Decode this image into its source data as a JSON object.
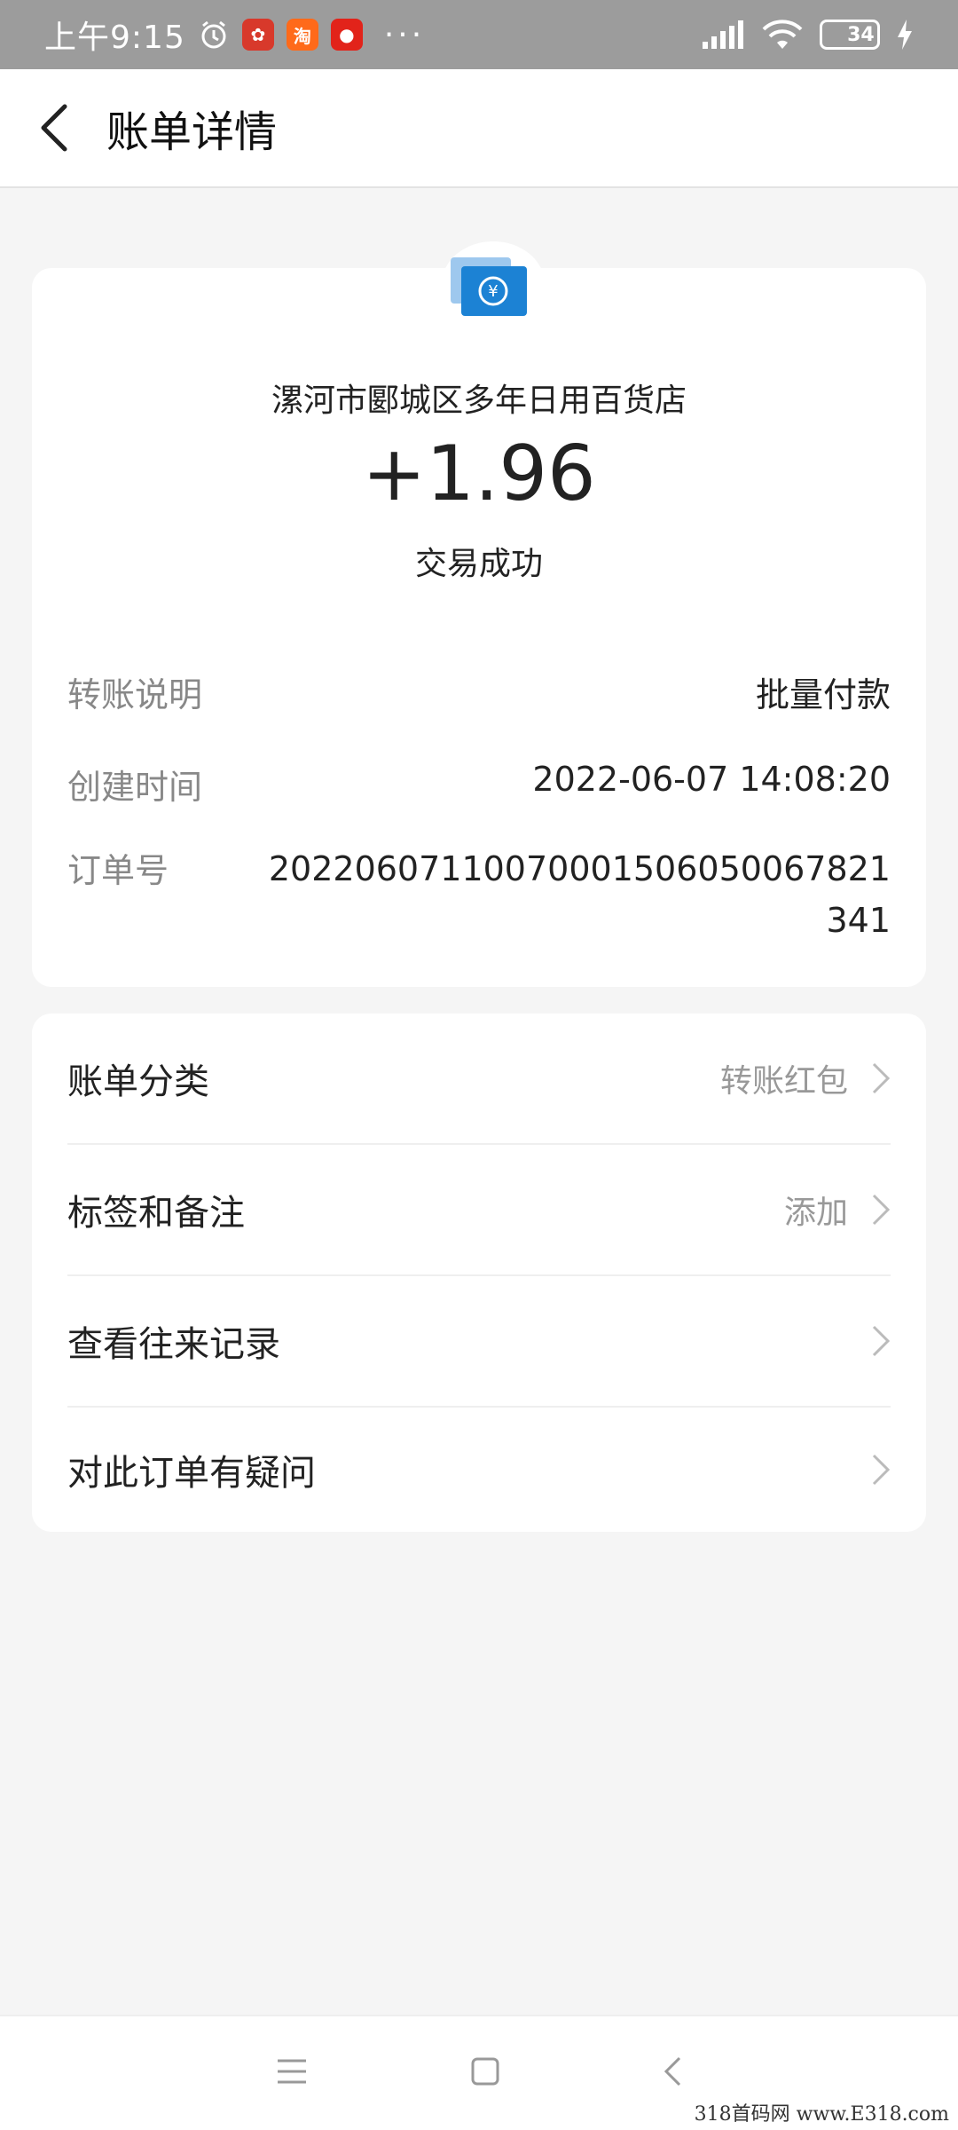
{
  "status_bar": {
    "time": "上午9:15",
    "battery": "34",
    "dots": "···"
  },
  "header": {
    "title": "账单详情"
  },
  "summary": {
    "merchant": "漯河市郾城区多年日用百货店",
    "amount": "+1.96",
    "status": "交易成功"
  },
  "details": [
    {
      "label": "转账说明",
      "value": "批量付款"
    },
    {
      "label": "创建时间",
      "value": "2022-06-07 14:08:20"
    },
    {
      "label": "订单号",
      "value": "20220607110070001506050067821341"
    }
  ],
  "menu": [
    {
      "label": "账单分类",
      "value": "转账红包"
    },
    {
      "label": "标签和备注",
      "value": "添加"
    },
    {
      "label": "查看往来记录",
      "value": ""
    },
    {
      "label": "对此订单有疑问",
      "value": ""
    }
  ],
  "colors": {
    "accent_blue": "#1c82d4",
    "status_bar_bg": "#9c9c9c"
  },
  "watermark": "318首码网 www.E318.com"
}
